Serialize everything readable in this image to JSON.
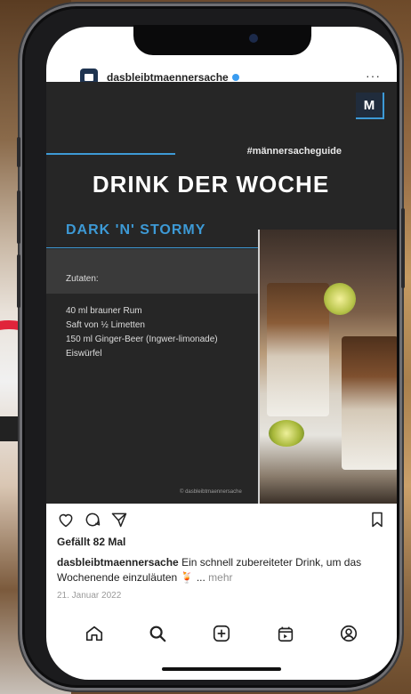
{
  "post": {
    "username": "dasbleibtmaennersache",
    "more_label": "···"
  },
  "graphic": {
    "logo_letter": "M",
    "hashtag": "#männersacheguide",
    "headline": "DRINK DER WOCHE",
    "drink_name": "DARK 'N' STORMY",
    "ingredients_label": "Zutaten:",
    "ingredients": [
      "40 ml brauner Rum",
      "Saft von ½ Limetten",
      "150 ml Ginger-Beer (Ingwer-limonade)",
      "Eiswürfel"
    ],
    "photo_credit": "© dasbleibtmaennersache"
  },
  "engagement": {
    "likes": "Gefällt 82 Mal",
    "caption_user": "dasbleibtmaennersache",
    "caption_text": " Ein schnell zubereiteter Drink, um das Wochenende einzuläuten 🍹 ...",
    "caption_more": " mehr",
    "date": "21. Januar 2022"
  },
  "icons": {
    "like": "heart-icon",
    "comment": "comment-icon",
    "share": "send-icon",
    "save": "bookmark-icon",
    "nav": [
      "home-icon",
      "search-icon",
      "add-post-icon",
      "shop-icon",
      "profile-icon"
    ]
  },
  "colors": {
    "accent_blue": "#3d9ad6",
    "graphic_bg": "#262626"
  }
}
